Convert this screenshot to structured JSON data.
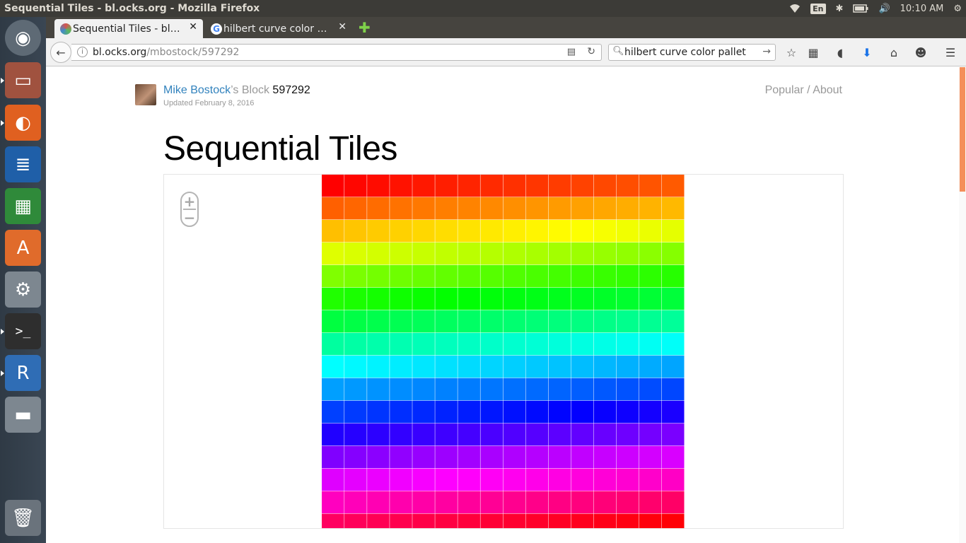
{
  "window": {
    "title": "Sequential Tiles - bl.ocks.org - Mozilla Firefox"
  },
  "system": {
    "keyboard": "En",
    "time": "10:10 AM"
  },
  "tabs": [
    {
      "label": "Sequential Tiles - bl…",
      "favicon_color": "#d9534f"
    },
    {
      "label": "hilbert curve color …",
      "favicon_color": "#4285f4"
    }
  ],
  "navbar": {
    "url_host": "bl.ocks.org",
    "url_path": "/mbostock/597292",
    "search_value": "hilbert curve color pallet"
  },
  "page": {
    "author": "Mike Bostock",
    "author_suffix": "’s Block ",
    "block_id": "597292",
    "updated": "Updated February 8, 2016",
    "nav_popular": "Popular",
    "nav_sep": " / ",
    "nav_about": "About",
    "title": "Sequential Tiles"
  },
  "zoom": {
    "plus": "+",
    "minus": "−"
  },
  "tiles": {
    "columns": 16,
    "rows_visible": 15.7,
    "hue_start": 0,
    "hue_step_per_tile": 1.40625,
    "saturation": 100,
    "lightness": 50
  },
  "launcher": [
    {
      "name": "ubuntu-dash-icon",
      "color": "#5e6a75"
    },
    {
      "name": "files-icon",
      "color": "#a0523f"
    },
    {
      "name": "firefox-icon",
      "color": "#e06020"
    },
    {
      "name": "writer-icon",
      "color": "#1f5fa8"
    },
    {
      "name": "calc-icon",
      "color": "#2f8a3a"
    },
    {
      "name": "software-center-icon",
      "color": "#e06b2b"
    },
    {
      "name": "system-settings-icon",
      "color": "#7d8790"
    },
    {
      "name": "terminal-icon",
      "color": "#2e2e2e"
    },
    {
      "name": "rstudio-icon",
      "color": "#2f6db5"
    },
    {
      "name": "disk-icon",
      "color": "#7d8790"
    },
    {
      "name": "trash-icon",
      "color": "#6a737c"
    }
  ]
}
